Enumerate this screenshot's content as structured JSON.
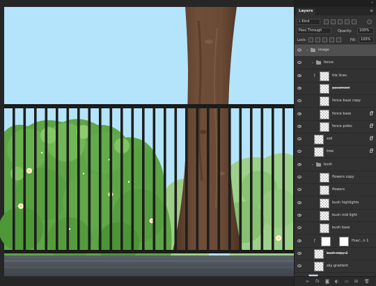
{
  "panel": {
    "tab": "Layers",
    "menu_icon": "panel-menu-icon",
    "filter_kind": "Kind",
    "blend_mode": "Pass Through",
    "opacity_label": "Opacity:",
    "opacity_value": "100%",
    "lock_label": "Lock:",
    "fill_label": "Fill:",
    "fill_value": "100%"
  },
  "layers": [
    {
      "name": "image",
      "kind": "group",
      "indent": 0,
      "selected": true
    },
    {
      "name": "fence",
      "kind": "group",
      "indent": 1
    },
    {
      "name": "tile lines",
      "kind": "layer",
      "indent": 2,
      "clipped": true
    },
    {
      "name": "pavement",
      "kind": "layer",
      "indent": 2,
      "strike": true
    },
    {
      "name": "fence base copy",
      "kind": "layer",
      "indent": 2
    },
    {
      "name": "fence base",
      "kind": "layer",
      "indent": 2,
      "locked": true
    },
    {
      "name": "fence poles",
      "kind": "layer",
      "indent": 2,
      "locked": true
    },
    {
      "name": "soil",
      "kind": "layer",
      "indent": 1,
      "locked": true
    },
    {
      "name": "tree",
      "kind": "layer",
      "indent": 1,
      "locked": true
    },
    {
      "name": "bush",
      "kind": "group",
      "indent": 1
    },
    {
      "name": "flowers copy",
      "kind": "layer",
      "indent": 2
    },
    {
      "name": "flowers",
      "kind": "layer",
      "indent": 2
    },
    {
      "name": "bush highlights",
      "kind": "layer",
      "indent": 2
    },
    {
      "name": "bush mid light",
      "kind": "layer",
      "indent": 2
    },
    {
      "name": "bush base",
      "kind": "layer",
      "indent": 2
    },
    {
      "name": "Hue/...n 1",
      "kind": "adjustment",
      "indent": 2
    },
    {
      "name": "bush copy 2",
      "kind": "layer",
      "indent": 1,
      "strike": true
    },
    {
      "name": "sky gradient",
      "kind": "layer",
      "indent": 1
    },
    {
      "name": "bg",
      "kind": "layer",
      "indent": 0,
      "thumb_color": "#a8dff8"
    }
  ],
  "footer": {
    "icons": [
      "link-icon",
      "fx-icon",
      "mask-icon",
      "adjustment-icon",
      "new-group-icon",
      "new-layer-icon",
      "trash-icon"
    ]
  },
  "colors": {
    "sky": "#b3e4fb",
    "bush_dark": "#4f9a3c",
    "bush_light": "#7fc05b",
    "tree_trunk": "#6b4b36",
    "fence": "#1b1b1b",
    "pavement": "#4d535b",
    "panel_bg": "#323232",
    "selection": "#505050"
  }
}
